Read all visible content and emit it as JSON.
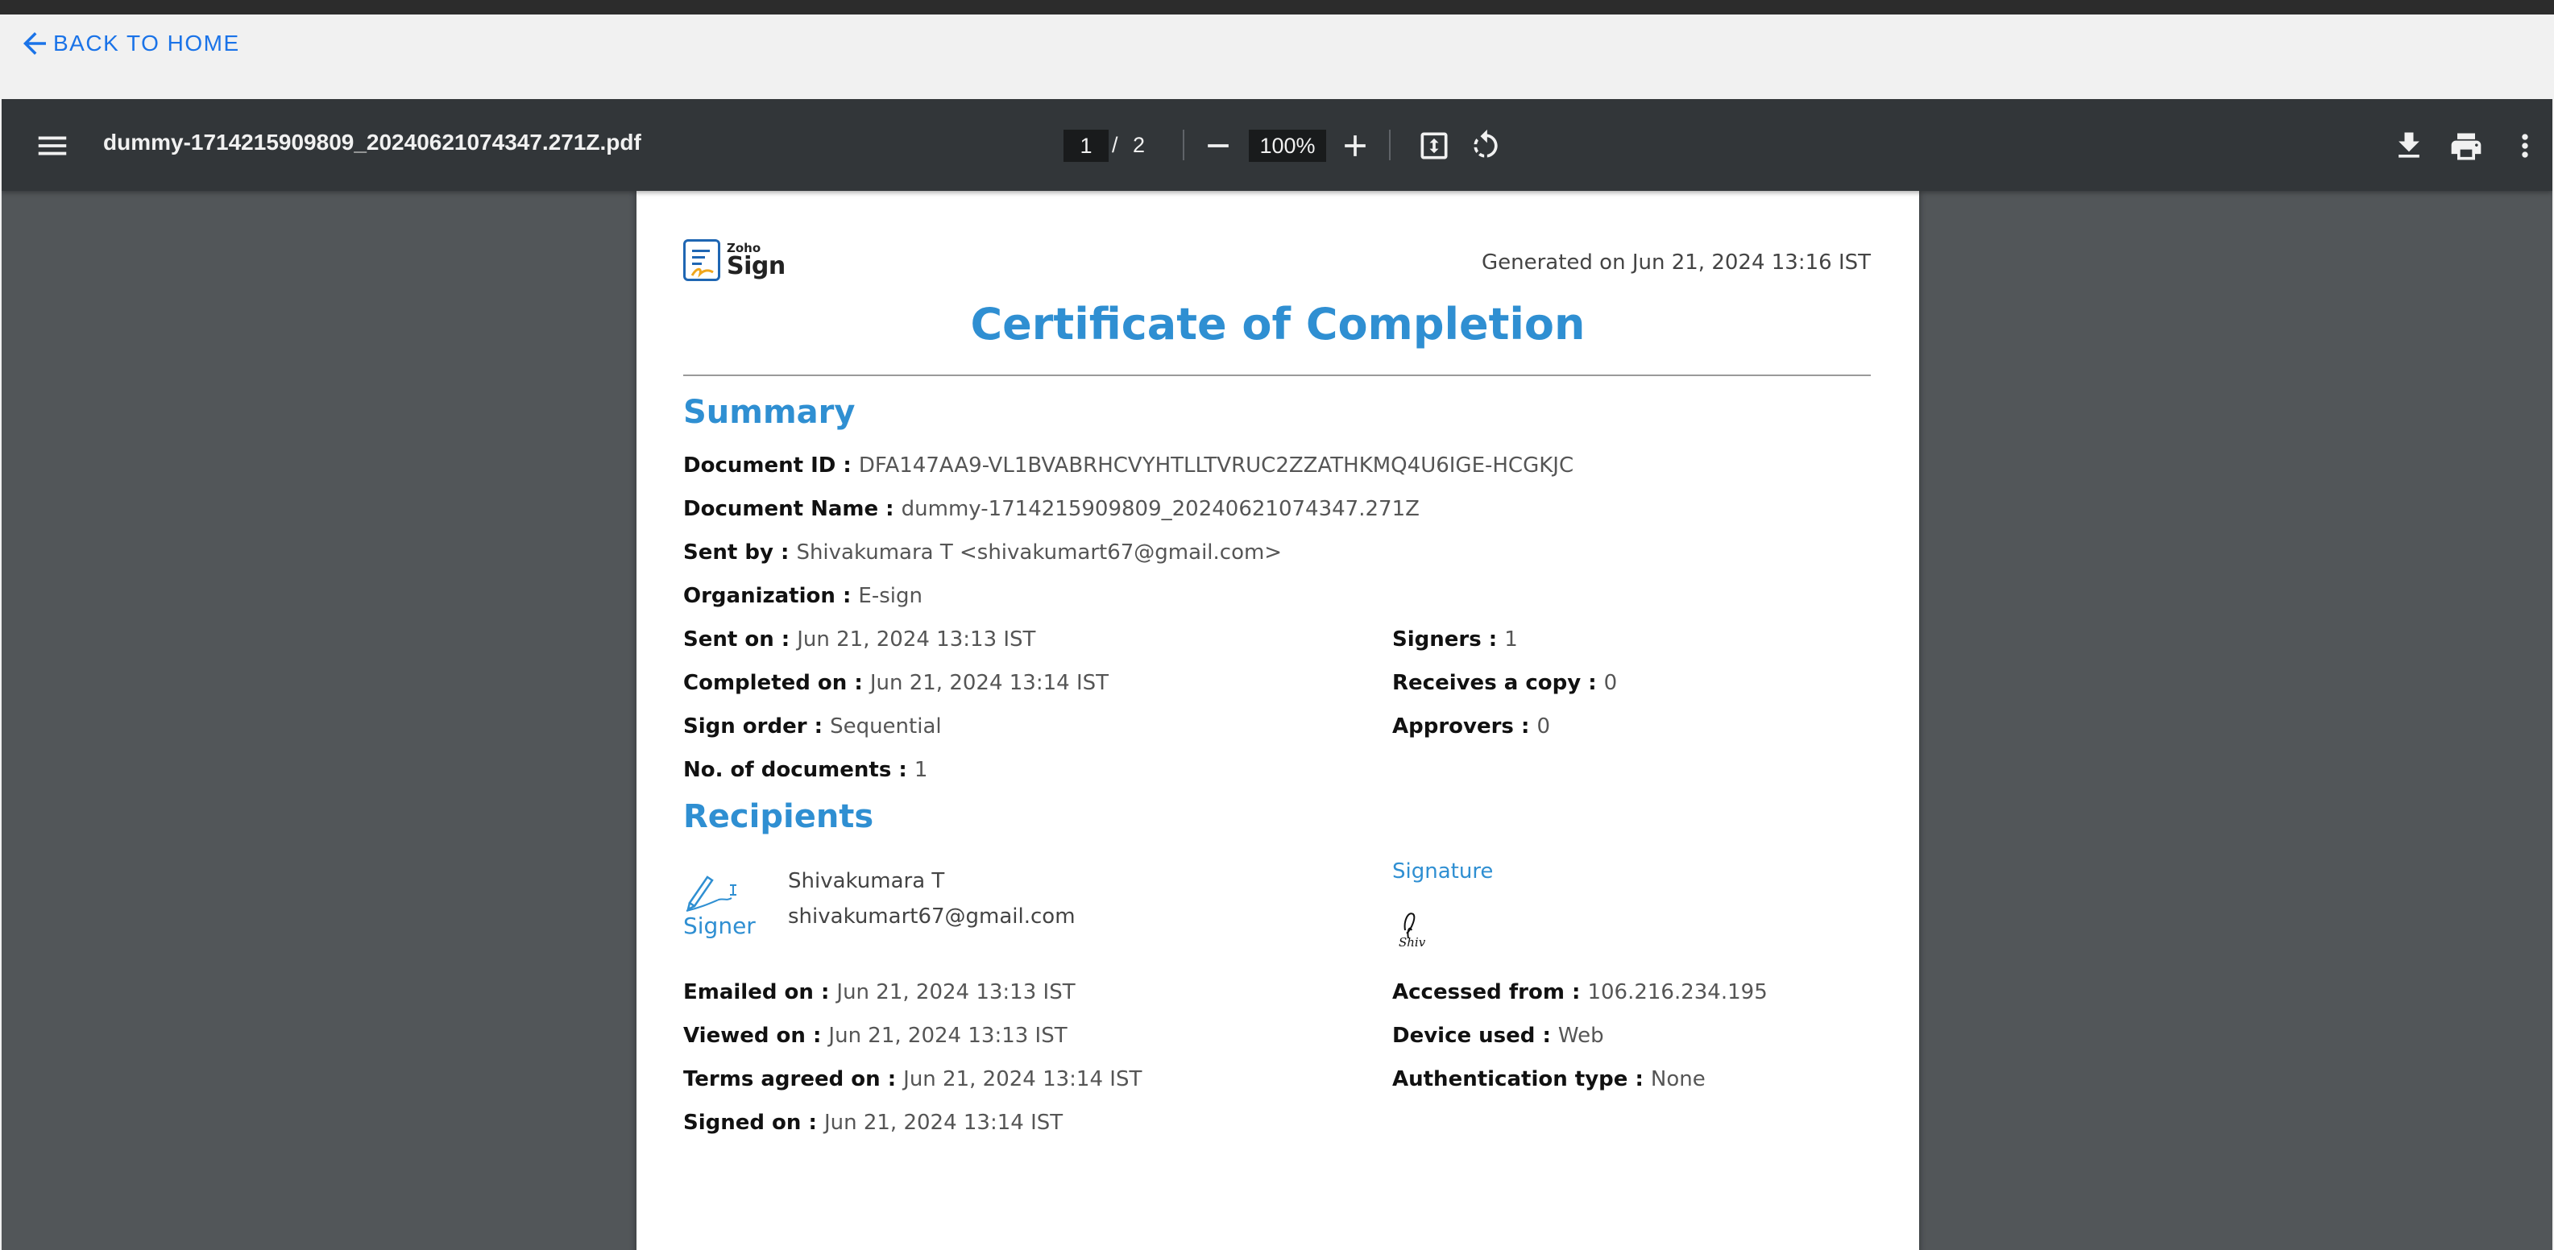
{
  "nav": {
    "back_label": "BACK TO HOME"
  },
  "toolbar": {
    "filename": "dummy-1714215909809_20240621074347.271Z.pdf",
    "current_page": "1",
    "page_separator": "/",
    "total_pages": "2",
    "zoom": "100%"
  },
  "icons": [
    "arrow-left-icon",
    "menu-icon",
    "zoom-out-icon",
    "zoom-in-icon",
    "fit-page-icon",
    "rotate-icon",
    "download-icon",
    "print-icon",
    "more-vert-icon",
    "signer-pen-icon"
  ],
  "colors": {
    "accent": "#2f8fd2",
    "link": "#1a73e8",
    "toolbar": "#323639",
    "viewer_bg": "#525659"
  },
  "document": {
    "logo": {
      "top": "Zoho",
      "bottom": "Sign"
    },
    "generated": "Generated on Jun 21, 2024 13:16 IST",
    "title": "Certificate of Completion",
    "summary": {
      "heading": "Summary",
      "document_id": {
        "label": "Document ID",
        "value": "DFA147AA9-VL1BVABRHCVYHTLLTVRUC2ZZATHKMQ4U6IGE-HCGKJC"
      },
      "document_name": {
        "label": "Document Name",
        "value": "dummy-1714215909809_20240621074347.271Z"
      },
      "sent_by": {
        "label": "Sent by",
        "value": "Shivakumara T <shivakumart67@gmail.com>"
      },
      "organization": {
        "label": "Organization",
        "value": "E-sign"
      },
      "sent_on": {
        "label": "Sent on",
        "value": "Jun 21, 2024 13:13 IST"
      },
      "completed_on": {
        "label": "Completed on",
        "value": "Jun 21, 2024 13:14 IST"
      },
      "sign_order": {
        "label": "Sign order",
        "value": "Sequential"
      },
      "num_documents": {
        "label": "No. of documents",
        "value": "1"
      },
      "signers": {
        "label": "Signers",
        "value": "1"
      },
      "receives_copy": {
        "label": "Receives a copy",
        "value": "0"
      },
      "approvers": {
        "label": "Approvers",
        "value": "0"
      }
    },
    "recipients": {
      "heading": "Recipients",
      "role": "Signer",
      "name": "Shivakumara T",
      "email": "shivakumart67@gmail.com",
      "signature_label": "Signature",
      "signature_text": "Shiv",
      "emailed_on": {
        "label": "Emailed on",
        "value": "Jun 21, 2024 13:13 IST"
      },
      "viewed_on": {
        "label": "Viewed on",
        "value": "Jun 21, 2024 13:13 IST"
      },
      "terms_agreed_on": {
        "label": "Terms agreed on",
        "value": "Jun 21, 2024 13:14 IST"
      },
      "signed_on": {
        "label": "Signed on",
        "value": "Jun 21, 2024 13:14 IST"
      },
      "accessed_from": {
        "label": "Accessed from",
        "value": "106.216.234.195"
      },
      "device_used": {
        "label": "Device used",
        "value": "Web"
      },
      "auth_type": {
        "label": "Authentication type",
        "value": "None"
      }
    }
  }
}
